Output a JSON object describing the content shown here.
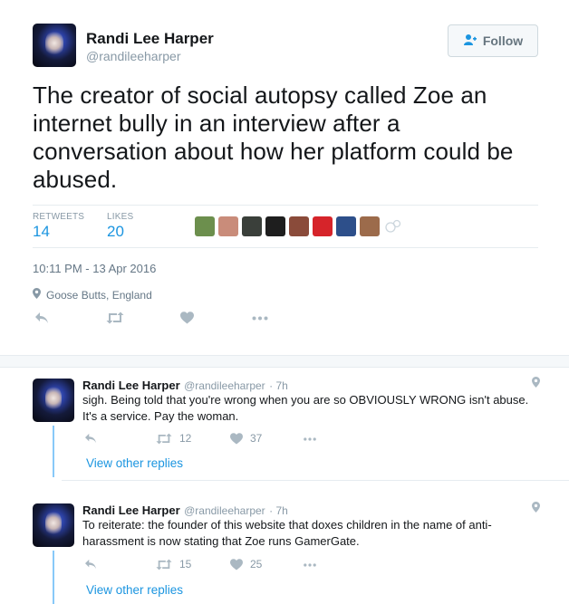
{
  "tweet": {
    "author_name": "Randi Lee Harper",
    "author_handle": "@randileeharper",
    "follow_label": "Follow",
    "text": "The creator of social autopsy called Zoe an internet bully in an interview after a conversation about how her platform could be abused.",
    "retweets_label": "RETWEETS",
    "retweets_count": "14",
    "likes_label": "LIKES",
    "likes_count": "20",
    "timestamp": "10:11 PM - 13 Apr 2016",
    "location": "Goose Butts, England",
    "liker_avatar_colors": [
      "#6c8f4d",
      "#c98c7a",
      "#3a3f3a",
      "#1e1e1e",
      "#8a4b3a",
      "#d6242a",
      "#2d4f8a",
      "#9c6b4b"
    ]
  },
  "replies": [
    {
      "author_name": "Randi Lee Harper",
      "author_handle": "@randileeharper",
      "time": "· 7h",
      "text": "sigh. Being told that you're wrong when you are so OBVIOUSLY WRONG isn't abuse. It's a service. Pay the woman.",
      "retweets": "12",
      "likes": "37",
      "view_replies": "View other replies"
    },
    {
      "author_name": "Randi Lee Harper",
      "author_handle": "@randileeharper",
      "time": "· 7h",
      "text": "To reiterate: the founder of this website that doxes children in the name of anti-harassment is now stating that Zoe runs GamerGate.",
      "retweets": "15",
      "likes": "25",
      "view_replies": "View other replies"
    }
  ],
  "icons": {
    "reply": "reply-icon",
    "retweet": "retweet-icon",
    "like": "heart-icon",
    "more": "more-icon",
    "location": "pin-icon",
    "follow": "follow-user-icon"
  },
  "colors": {
    "link_blue": "#1b95e0",
    "thread_line": "#88c9f9",
    "muted": "#8899a6"
  }
}
